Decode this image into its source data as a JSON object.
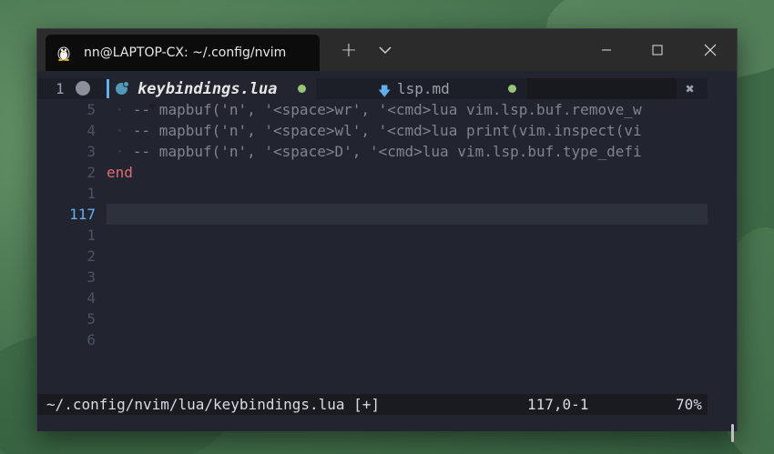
{
  "window": {
    "tab_title": "nn@LAPTOP-CX: ~/.config/nvim",
    "new_tab_label": "+"
  },
  "bufferline": {
    "tab_number": "1",
    "active_buffer": "keybindings.lua",
    "inactive_buffer": "lsp.md",
    "close_label": "✖",
    "modified_color": "#98c379"
  },
  "editor": {
    "lines": [
      {
        "num": "5",
        "indent": " · ",
        "text": "-- mapbuf('n', '<space>wr', '<cmd>lua vim.lsp.buf.remove_w",
        "current": false,
        "style": "comment"
      },
      {
        "num": "4",
        "indent": " · ",
        "text": "-- mapbuf('n', '<space>wl', '<cmd>lua print(vim.inspect(vi",
        "current": false,
        "style": "comment"
      },
      {
        "num": "3",
        "indent": " · ",
        "text": "-- mapbuf('n', '<space>D', '<cmd>lua vim.lsp.buf.type_defi",
        "current": false,
        "style": "comment"
      },
      {
        "num": "2",
        "indent": "",
        "text": "end",
        "current": false,
        "style": "keyword"
      },
      {
        "num": "1",
        "indent": "",
        "text": "",
        "current": false,
        "style": "plain"
      },
      {
        "num": "117",
        "indent": "",
        "text": "",
        "current": true,
        "style": "plain"
      },
      {
        "num": "1",
        "indent": "",
        "text": "",
        "current": false,
        "style": "plain"
      },
      {
        "num": "2",
        "indent": "",
        "text": "",
        "current": false,
        "style": "plain"
      },
      {
        "num": "3",
        "indent": "",
        "text": "",
        "current": false,
        "style": "plain"
      },
      {
        "num": "4",
        "indent": "",
        "text": "",
        "current": false,
        "style": "plain"
      },
      {
        "num": "5",
        "indent": "",
        "text": "",
        "current": false,
        "style": "plain"
      },
      {
        "num": "6",
        "indent": "",
        "text": "",
        "current": false,
        "style": "plain"
      }
    ]
  },
  "statusline": {
    "file": "~/.config/nvim/lua/keybindings.lua [+]",
    "position": "117,0-1",
    "percent": "70%"
  },
  "colors": {
    "accent": "#61afef",
    "keyword": "#e06c75",
    "comment": "#7f848e",
    "background": "#222530"
  }
}
